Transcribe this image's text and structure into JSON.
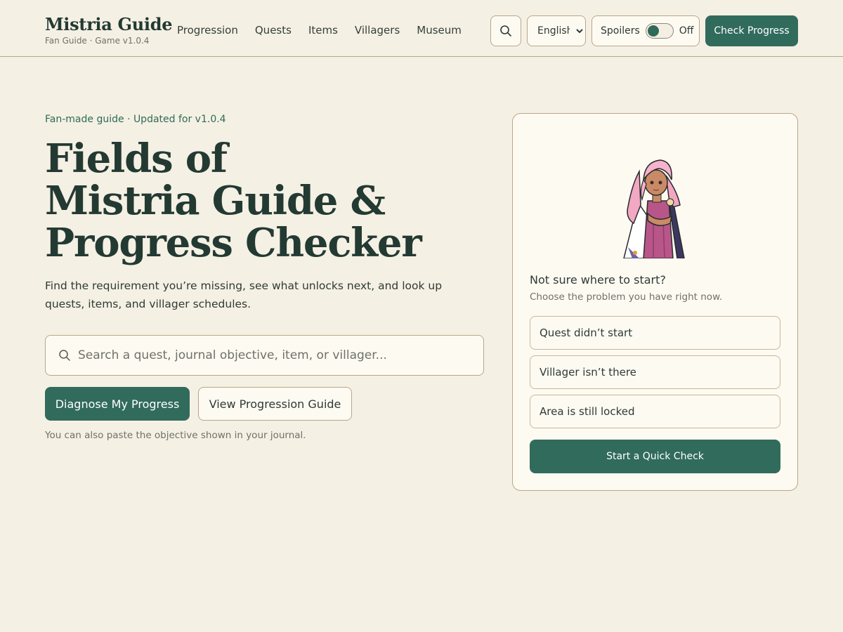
{
  "header": {
    "brand_title": "Mistria Guide",
    "brand_sub": "Fan Guide · Game v1.0.4",
    "nav": [
      "Progression",
      "Quests",
      "Items",
      "Villagers",
      "Museum"
    ],
    "search_icon": "search-icon",
    "language": {
      "selected": "English",
      "options": [
        "English"
      ]
    },
    "spoilers": {
      "label": "Spoilers",
      "state": "Off",
      "enabled": false
    },
    "cta_label": "Check Progress"
  },
  "hero": {
    "eyebrow": "Fan-made guide · Updated for v1.0.4",
    "title_lines": [
      "Fields of",
      "Mistria Guide &",
      "Progress Checker"
    ],
    "description": "Find the requirement you’re missing, see what unlocks next, and look up quests, items, and villager schedules.",
    "search_placeholder": "Search a quest, journal objective, item, or villager...",
    "primary_label": "Diagnose My Progress",
    "secondary_label": "View Progression Guide",
    "hint": "You can also paste the objective shown in your journal."
  },
  "card": {
    "title": "Not sure where to start?",
    "subtitle": "Choose the problem you have right now.",
    "options": [
      "Quest didn’t start",
      "Villager isn’t there",
      "Area is still locked"
    ],
    "cta_label": "Start a Quick Check"
  },
  "colors": {
    "background": "#f5f0e4",
    "accent": "#316b5c",
    "heading": "#233a33",
    "border": "#b9a789"
  }
}
